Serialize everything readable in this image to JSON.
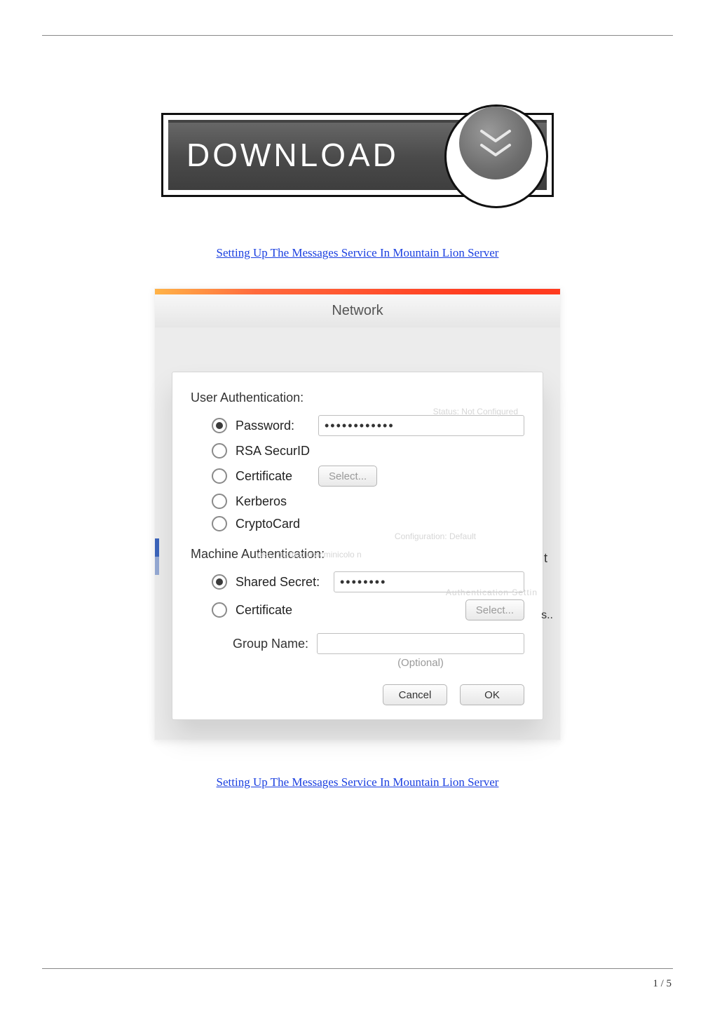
{
  "article": {
    "link_text": "Setting Up The Messages Service In Mountain Lion Server"
  },
  "download": {
    "label": "DOWNLOAD"
  },
  "panel": {
    "title": "Network",
    "search_placeholder": "",
    "ghost_status": "Status:   Not Configured",
    "ghost_config": "Configuration:    Default",
    "ghost_server": "ress:   testbed macminicolo n",
    "ghost_auth": "Authentication Settin",
    "ghost_t": "t",
    "right_hint": "s..",
    "user_auth": {
      "heading": "User Authentication:",
      "options": [
        {
          "key": "password",
          "label": "Password:",
          "selected": true,
          "value_mask": "••••••••••••"
        },
        {
          "key": "rsa",
          "label": "RSA SecurID",
          "selected": false
        },
        {
          "key": "cert",
          "label": "Certificate",
          "selected": false,
          "select_btn": "Select..."
        },
        {
          "key": "kerberos",
          "label": "Kerberos",
          "selected": false
        },
        {
          "key": "cryptocard",
          "label": "CryptoCard",
          "selected": false
        }
      ]
    },
    "machine_auth": {
      "heading": "Machine Authentication:",
      "options": [
        {
          "key": "shared",
          "label": "Shared Secret:",
          "selected": true,
          "value_mask": "••••••••"
        },
        {
          "key": "cert",
          "label": "Certificate",
          "selected": false,
          "select_btn": "Select..."
        }
      ]
    },
    "group": {
      "label": "Group Name:",
      "value": "",
      "optional": "(Optional)"
    },
    "actions": {
      "cancel": "Cancel",
      "ok": "OK"
    }
  },
  "footer": {
    "page": "1 / 5"
  }
}
